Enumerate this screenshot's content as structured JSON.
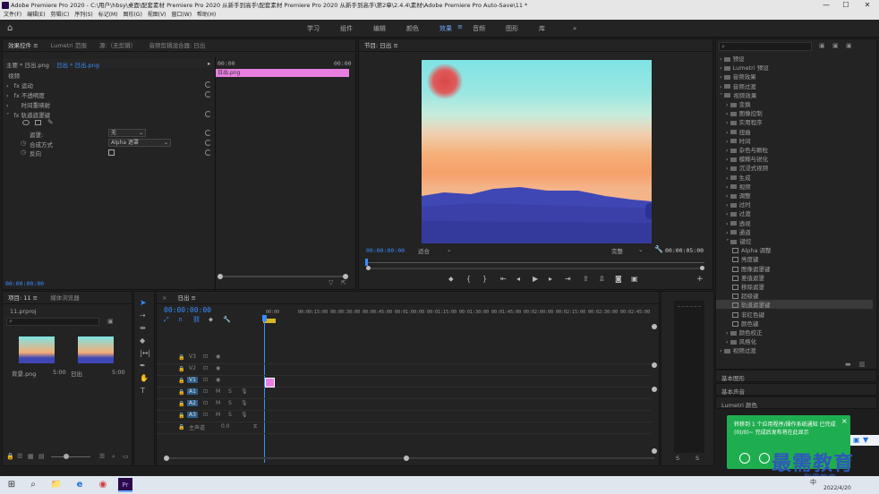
{
  "window": {
    "title": "Adobe Premiere Pro 2020 - C:\\用户\\hbsy\\桌面\\配套素材 Premiere Pro 2020 从新手到高手\\配套素材 Premiere Pro 2020 从新手到高手\\第2章\\2.4.4\\素材\\Adobe Premiere Pro Auto-Save\\11 *",
    "minimize": "—",
    "maximize": "☐",
    "close": "✕"
  },
  "menubar": [
    "文件(F)",
    "编辑(E)",
    "剪辑(C)",
    "序列(S)",
    "标记(M)",
    "图形(G)",
    "视图(V)",
    "窗口(W)",
    "帮助(H)"
  ],
  "workspaces": {
    "items": [
      "学习",
      "组件",
      "编辑",
      "颜色",
      "效果",
      "音频",
      "图形",
      "库"
    ],
    "active": "效果",
    "more": "»"
  },
  "effect_controls": {
    "tabs": [
      "效果控件 ≡",
      "Lumetri 范围",
      "源:（无剪辑）",
      "音频剪辑混合器: 日出"
    ],
    "master": "主要 * 日出.png",
    "clip": "日出 * 日出.png",
    "time_start": "00:00",
    "time_end": "00:00",
    "clip_bar_label": "日出.png",
    "section_video": "视频",
    "fx_motion": "运动",
    "fx_opacity": "不透明度",
    "fx_time_remap": "时间重映射",
    "fx_effect": "轨道遮罩键",
    "param_matte": "遮罩:",
    "param_matte_value": "无",
    "param_composite": "合成方式",
    "param_composite_value": "Alpha 遮罩",
    "param_reverse": "反向",
    "timecode": "00:00:00:00"
  },
  "program": {
    "title": "节目: 日出 ≡",
    "timecode_in": "00:00:00:00",
    "fit": "适合",
    "quality": "完整",
    "timecode_out": "00:00:05:00"
  },
  "effects_panel": {
    "search_placeholder": "",
    "tree": [
      {
        "label": "预设",
        "level": 0,
        "type": "folder"
      },
      {
        "label": "Lumetri 预设",
        "level": 0,
        "type": "folder"
      },
      {
        "label": "音频效果",
        "level": 0,
        "type": "folder"
      },
      {
        "label": "音频过渡",
        "level": 0,
        "type": "folder"
      },
      {
        "label": "视频效果",
        "level": 0,
        "type": "folder",
        "open": true
      },
      {
        "label": "变换",
        "level": 1,
        "type": "folder"
      },
      {
        "label": "图像控制",
        "level": 1,
        "type": "folder"
      },
      {
        "label": "实用程序",
        "level": 1,
        "type": "folder"
      },
      {
        "label": "扭曲",
        "level": 1,
        "type": "folder"
      },
      {
        "label": "时间",
        "level": 1,
        "type": "folder"
      },
      {
        "label": "杂色与颗粒",
        "level": 1,
        "type": "folder"
      },
      {
        "label": "模糊与锐化",
        "level": 1,
        "type": "folder"
      },
      {
        "label": "沉浸式视频",
        "level": 1,
        "type": "folder"
      },
      {
        "label": "生成",
        "level": 1,
        "type": "folder"
      },
      {
        "label": "视频",
        "level": 1,
        "type": "folder"
      },
      {
        "label": "调整",
        "level": 1,
        "type": "folder"
      },
      {
        "label": "过时",
        "level": 1,
        "type": "folder"
      },
      {
        "label": "过渡",
        "level": 1,
        "type": "folder"
      },
      {
        "label": "透视",
        "level": 1,
        "type": "folder"
      },
      {
        "label": "通道",
        "level": 1,
        "type": "folder"
      },
      {
        "label": "键控",
        "level": 1,
        "type": "folder",
        "open": true
      },
      {
        "label": "Alpha 调整",
        "level": 2,
        "type": "fx"
      },
      {
        "label": "亮度键",
        "level": 2,
        "type": "fx"
      },
      {
        "label": "图像遮罩键",
        "level": 2,
        "type": "fx"
      },
      {
        "label": "差值遮罩",
        "level": 2,
        "type": "fx"
      },
      {
        "label": "移除遮罩",
        "level": 2,
        "type": "fx"
      },
      {
        "label": "超级键",
        "level": 2,
        "type": "fx"
      },
      {
        "label": "轨道遮罩键",
        "level": 2,
        "type": "fx",
        "selected": true
      },
      {
        "label": "非红色键",
        "level": 2,
        "type": "fx"
      },
      {
        "label": "颜色键",
        "level": 2,
        "type": "fx"
      },
      {
        "label": "颜色校正",
        "level": 1,
        "type": "folder"
      },
      {
        "label": "风格化",
        "level": 1,
        "type": "folder"
      },
      {
        "label": "视频过渡",
        "level": 0,
        "type": "folder"
      }
    ],
    "sub_panels": [
      "基本图形",
      "基本声音",
      "Lumetri 颜色"
    ]
  },
  "project": {
    "tabs": [
      "项目: 11 ≡",
      "媒体浏览器"
    ],
    "file": "11.prproj",
    "items": [
      {
        "name": "背景.png",
        "duration": "5:00"
      },
      {
        "name": "日出",
        "duration": "5:00"
      }
    ]
  },
  "timeline": {
    "title": "日出 ≡",
    "timecode": "00:00:00:00",
    "ruler": [
      "00:00",
      "00:00:15:00",
      "00:00:30:00",
      "00:00:45:00",
      "00:01:00:00",
      "00:01:15:00",
      "00:01:30:00",
      "00:01:45:00",
      "00:02:00:00",
      "00:02:15:00",
      "00:02:30:00",
      "00:02:45:00"
    ],
    "video_tracks": [
      "V3",
      "V2",
      "V1"
    ],
    "audio_tracks": [
      "A1",
      "A2",
      "A3"
    ],
    "master": "主声道",
    "master_value": "0.0",
    "meter_labels": [
      "S",
      "S"
    ]
  },
  "notification": {
    "text": "转移到 1 个应用程序/操作系统通知 已完成 (0)/0)~  完成后发布将在此显示",
    "close": "×"
  },
  "watermark": {
    "line1": "最需教育",
    "line2": "取需教育"
  },
  "taskbar": {
    "time": "2022/4/20",
    "lang": "中",
    "apps": [
      "⊞",
      "⌕",
      "📁",
      "e",
      "◉",
      "Pr"
    ]
  },
  "colors": {
    "accent": "#3a8cff",
    "clip_pink": "#e87fe0",
    "selected_row": "#3a3a3a"
  }
}
